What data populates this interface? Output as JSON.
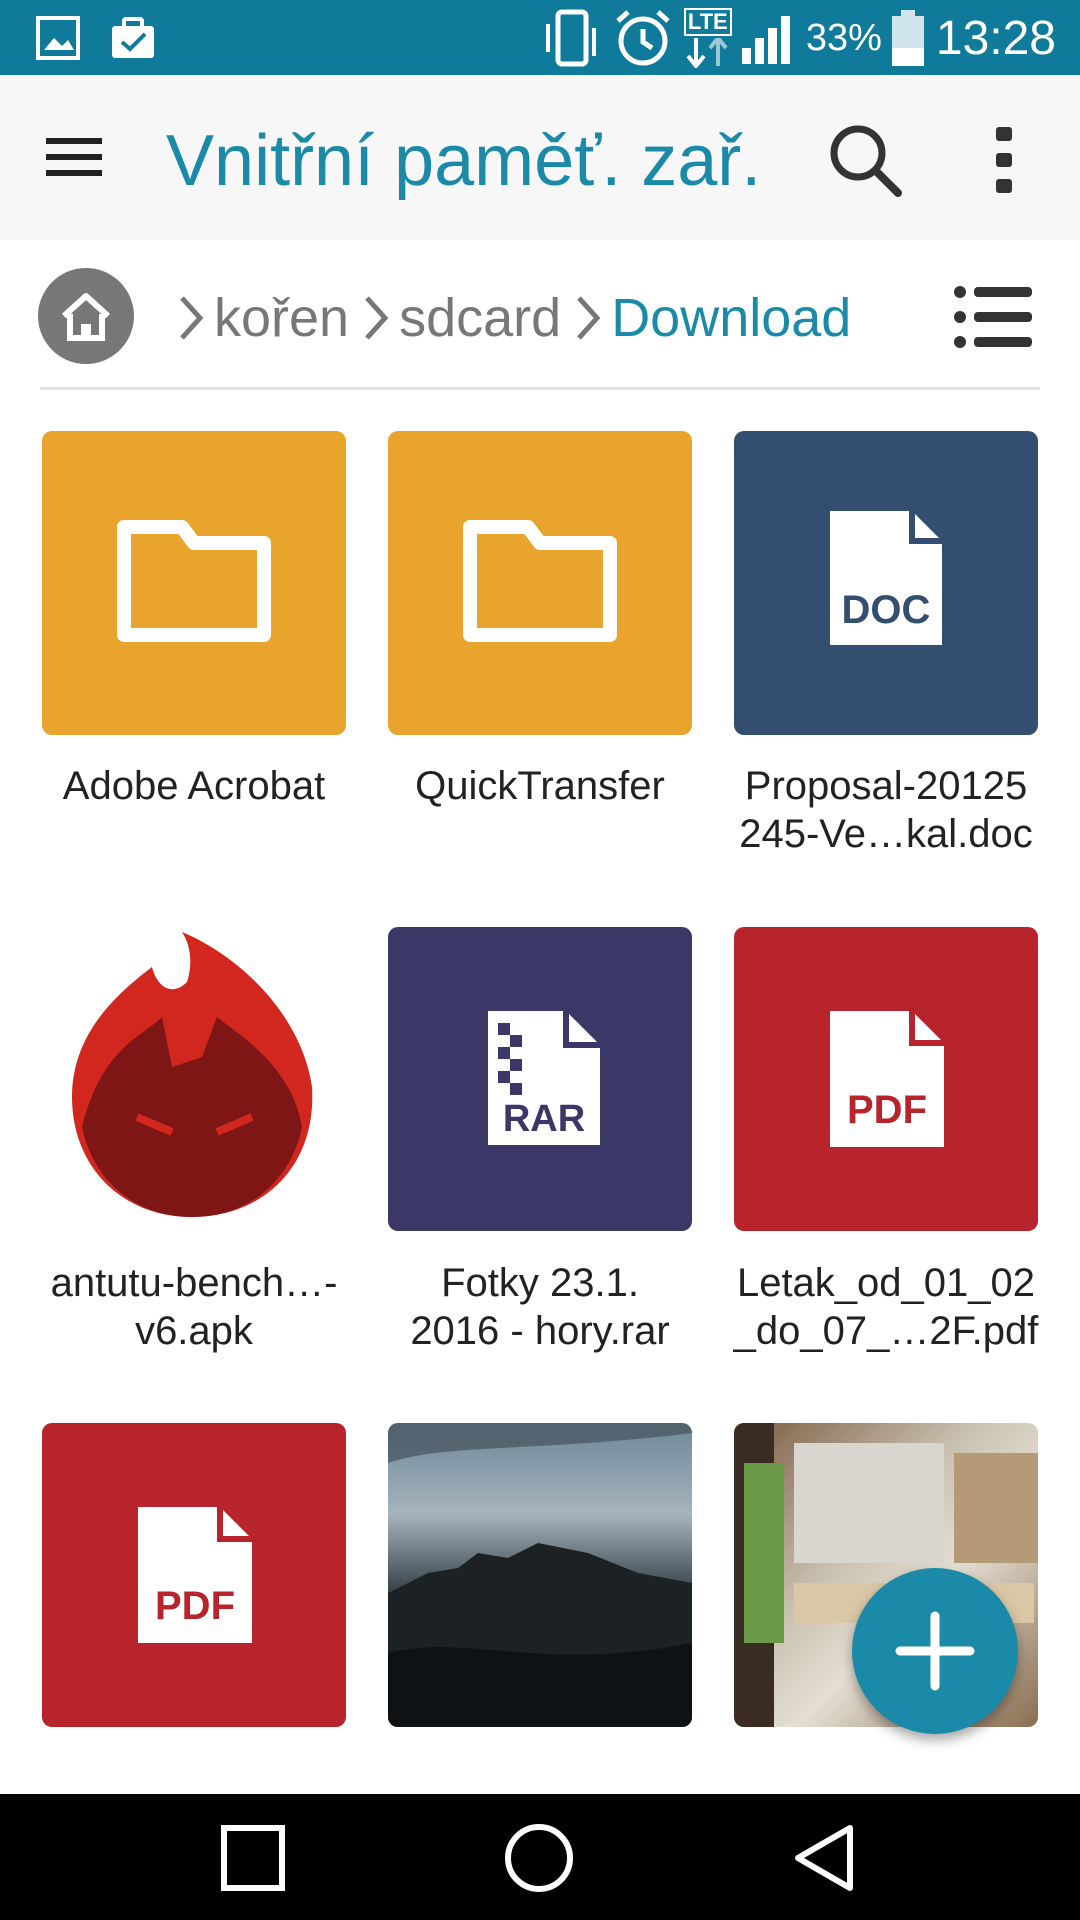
{
  "status_bar": {
    "battery_percent": "33%",
    "time": "13:28",
    "network": "LTE",
    "icons": [
      "image-notification-icon",
      "work-notification-icon",
      "vibrate-icon",
      "alarm-icon",
      "lte-icon",
      "signal-icon",
      "battery-icon"
    ]
  },
  "app_bar": {
    "title": "Vnitřní paměť. zař.",
    "icons": [
      "menu-icon",
      "search-icon",
      "more-vert-icon"
    ]
  },
  "breadcrumb": {
    "items": [
      {
        "label": "kořen"
      },
      {
        "label": "sdcard"
      },
      {
        "label": "Download"
      }
    ]
  },
  "files": [
    {
      "line1": "Adobe Acrobat",
      "line2": "",
      "type": "folder",
      "color": "#e8a42c"
    },
    {
      "line1": "QuickTransfer",
      "line2": "",
      "type": "folder",
      "color": "#e8a42c"
    },
    {
      "line1": "Proposal-20125",
      "line2": "245-Ve…kal.doc",
      "type": "doc",
      "badge": "DOC",
      "color": "#334e6e"
    },
    {
      "line1": "antutu-bench…-",
      "line2": "v6.apk",
      "type": "apk",
      "color": "#d1271f"
    },
    {
      "line1": "Fotky 23.1.",
      "line2": "2016 - hory.rar",
      "type": "rar",
      "badge": "RAR",
      "color": "#3b3766"
    },
    {
      "line1": "Letak_od_01_02",
      "line2": "_do_07_…2F.pdf",
      "type": "pdf",
      "badge": "PDF",
      "color": "#b8242c"
    },
    {
      "line1": "",
      "line2": "",
      "type": "pdf",
      "badge": "PDF",
      "color": "#b8242c"
    },
    {
      "line1": "",
      "line2": "",
      "type": "photo"
    },
    {
      "line1": "",
      "line2": "",
      "type": "photo"
    }
  ],
  "fab": {
    "icon": "add-icon",
    "color": "#1b8aa8"
  },
  "nav_bar": {
    "icons": [
      "recents-icon",
      "home-circle-icon",
      "back-icon"
    ]
  }
}
